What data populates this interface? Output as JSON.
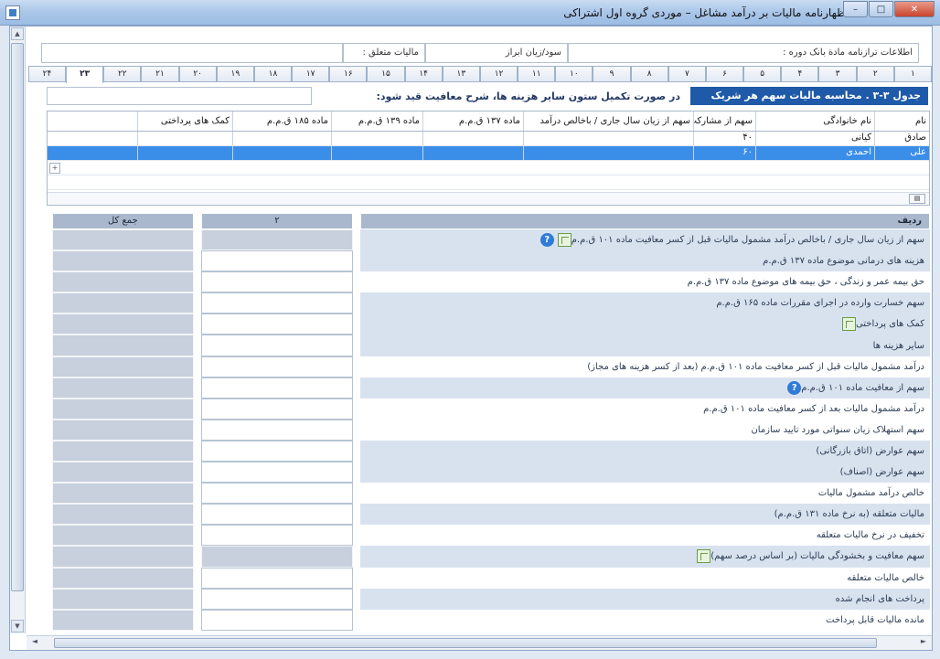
{
  "window": {
    "title": "اظهارنامه مالیات بر درآمد مشاغل – موردی گروه اول اشتراکی",
    "min": "–",
    "max": "□",
    "close": "✕"
  },
  "info": {
    "field1": "اطلاعات ترازنامه مادة بانک دوره :",
    "field2": "سود/زیان ابراز",
    "field3": "مالیات متعلق :",
    "field4": ""
  },
  "tabs": [
    "۱",
    "۲",
    "۳",
    "۴",
    "۵",
    "۶",
    "۷",
    "۸",
    "۹",
    "۱۰",
    "۱۱",
    "۱۲",
    "۱۳",
    "۱۴",
    "۱۵",
    "۱۶",
    "۱۷",
    "۱۸",
    "۱۹",
    "۲۰",
    "۲۱",
    "۲۲",
    "۲۳",
    "۲۴"
  ],
  "active_tab_index": 22,
  "table_title": "جدول ۳-۳ . محاسبه مالیات سهم هر شریک",
  "help_text": "در صورت تکمیل ستون سایر هزینه ها، شرح معافیت قید شود:",
  "partner_grid": {
    "headers": [
      "نام",
      "نام خانوادگی",
      "سهم از مشارکت",
      "سهم از زیان سال جاری / باخالص درآمد",
      "ماده ۱۳۷ ق.م.م",
      "ماده ۱۳۹ ق.م.م",
      "ماده ۱۸۵ ق.م.م",
      "کمک های پرداختی"
    ],
    "rows": [
      [
        "صادق",
        "کیانی",
        "۴۰",
        "",
        "",
        "",
        "",
        ""
      ],
      [
        "علی",
        "احمدی",
        "۶۰",
        "",
        "",
        "",
        "",
        ""
      ]
    ]
  },
  "calc": {
    "headers": {
      "label": "ردیف",
      "col2": "۲",
      "total": "جمع کل"
    },
    "rows": [
      {
        "label": "سهم از زیان سال جاری / باخالص درآمد مشمول مالیات قبل از کسر معافیت ماده ۱۰۱ ق.م.م",
        "icon": "grid-help",
        "style": "shade",
        "value_grey": true
      },
      {
        "label": "هزینه های درمانی موضوع ماده ۱۳۷ ق.م.م",
        "icon": "",
        "style": "shade",
        "value_grey": false
      },
      {
        "label": "حق بیمه عمر و زندگی ، حق بیمه های موضوع ماده ۱۳۷ ق.م.م",
        "icon": "",
        "style": "plain",
        "value_grey": false
      },
      {
        "label": "سهم خسارت وارده در اجرای مقررات ماده ۱۶۵ ق.م.م",
        "icon": "",
        "style": "shade",
        "value_grey": false
      },
      {
        "label": "کمک های پرداختی",
        "icon": "grid",
        "style": "shade",
        "value_grey": false
      },
      {
        "label": "سایر هزینه ها",
        "icon": "",
        "style": "shade",
        "value_grey": false
      },
      {
        "label": "درآمد مشمول مالیات قبل از کسر معافیت ماده ۱۰۱ ق.م.م (بعد از کسر هزینه های مجاز)",
        "icon": "",
        "style": "plain",
        "value_grey": false
      },
      {
        "label": "سهم از معافیت ماده ۱۰۱ ق.م.م",
        "icon": "help",
        "style": "shade",
        "value_grey": false
      },
      {
        "label": "درآمد مشمول مالیات بعد از کسر معافیت ماده ۱۰۱ ق.م.م",
        "icon": "",
        "style": "plain",
        "value_grey": false
      },
      {
        "label": "سهم استهلاک زیان سنواتی مورد تایید سازمان",
        "icon": "",
        "style": "plain",
        "value_grey": false
      },
      {
        "label": "سهم عوارض (اتاق بازرگانی)",
        "icon": "",
        "style": "shade",
        "value_grey": false
      },
      {
        "label": "سهم عوارض (اصناف)",
        "icon": "",
        "style": "shade",
        "value_grey": false
      },
      {
        "label": "خالص درآمد مشمول مالیات",
        "icon": "",
        "style": "plain",
        "value_grey": false
      },
      {
        "label": "مالیات متعلقه (به نرخ ماده ۱۳۱ ق.م.م)",
        "icon": "",
        "style": "shade",
        "value_grey": false
      },
      {
        "label": "تخفیف در نرخ مالیات متعلقه",
        "icon": "",
        "style": "plain",
        "value_grey": false
      },
      {
        "label": "سهم معافیت و بخشودگی مالیات (بر اساس درصد سهم)",
        "icon": "grid",
        "style": "shade",
        "value_grey": true
      },
      {
        "label": "خالص مالیات متعلقه",
        "icon": "",
        "style": "plain",
        "value_grey": false
      },
      {
        "label": "پرداخت های انجام شده",
        "icon": "",
        "style": "shade",
        "value_grey": false
      },
      {
        "label": "مانده مالیات قابل پرداخت",
        "icon": "",
        "style": "plain",
        "value_grey": false
      }
    ]
  }
}
